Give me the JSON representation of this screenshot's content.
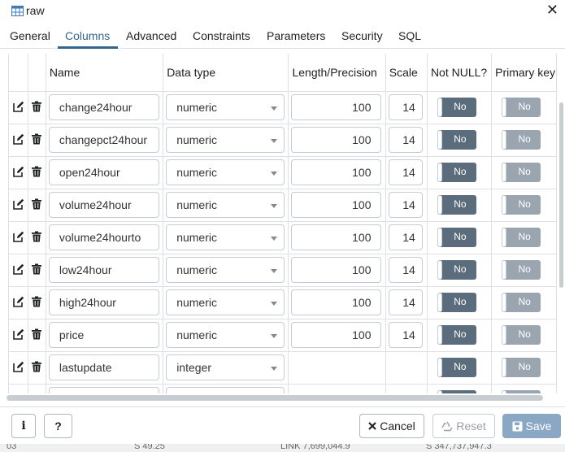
{
  "window": {
    "title": "raw",
    "icon": "table-icon",
    "close": "✕"
  },
  "tabs": [
    {
      "label": "General",
      "active": false
    },
    {
      "label": "Columns",
      "active": true
    },
    {
      "label": "Advanced",
      "active": false
    },
    {
      "label": "Constraints",
      "active": false
    },
    {
      "label": "Parameters",
      "active": false
    },
    {
      "label": "Security",
      "active": false
    },
    {
      "label": "SQL",
      "active": false
    }
  ],
  "grid": {
    "headers": {
      "name": "Name",
      "data_type": "Data type",
      "length": "Length/Precision",
      "scale": "Scale",
      "not_null": "Not NULL?",
      "primary_key": "Primary key"
    },
    "rows": [
      {
        "name": "change24hour",
        "type": "numeric",
        "length": "100",
        "scale": "14",
        "not_null": "No",
        "primary_key": "No"
      },
      {
        "name": "changepct24hour",
        "type": "numeric",
        "length": "100",
        "scale": "14",
        "not_null": "No",
        "primary_key": "No"
      },
      {
        "name": "open24hour",
        "type": "numeric",
        "length": "100",
        "scale": "14",
        "not_null": "No",
        "primary_key": "No"
      },
      {
        "name": "volume24hour",
        "type": "numeric",
        "length": "100",
        "scale": "14",
        "not_null": "No",
        "primary_key": "No"
      },
      {
        "name": "volume24hourto",
        "type": "numeric",
        "length": "100",
        "scale": "14",
        "not_null": "No",
        "primary_key": "No"
      },
      {
        "name": "low24hour",
        "type": "numeric",
        "length": "100",
        "scale": "14",
        "not_null": "No",
        "primary_key": "No"
      },
      {
        "name": "high24hour",
        "type": "numeric",
        "length": "100",
        "scale": "14",
        "not_null": "No",
        "primary_key": "No"
      },
      {
        "name": "price",
        "type": "numeric",
        "length": "100",
        "scale": "14",
        "not_null": "No",
        "primary_key": "No"
      },
      {
        "name": "lastupdate",
        "type": "integer",
        "length": "",
        "scale": "",
        "not_null": "No",
        "primary_key": "No"
      },
      {
        "name": "",
        "type": "",
        "length": "",
        "scale": "",
        "not_null": "",
        "primary_key": ""
      }
    ]
  },
  "footer": {
    "info": "i",
    "help": "?",
    "cancel": "Cancel",
    "reset": "Reset",
    "save": "Save"
  },
  "statusbar": {
    "c1": "03",
    "c2": "S 49.25",
    "c3": "LINK 7,699,044.9",
    "c4": "S 347,737,947.3"
  },
  "colors": {
    "accent": "#326690",
    "toggle_dark": "#5b6d7c",
    "toggle_light": "#9aa5af",
    "save_bg": "#8aa8c4"
  }
}
